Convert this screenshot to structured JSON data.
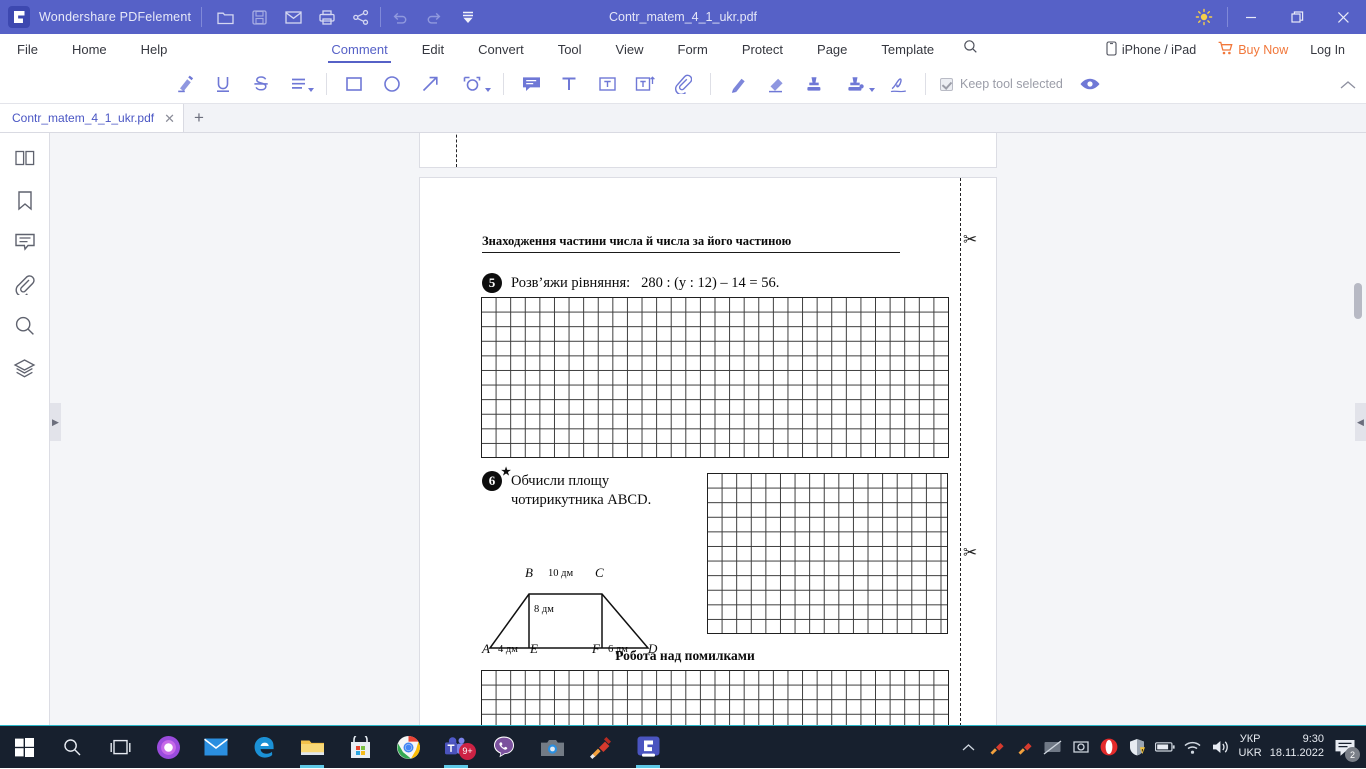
{
  "app": {
    "name": "Wondershare PDFelement",
    "document_title": "Contr_matem_4_1_ukr.pdf",
    "logo_icon": "pdfelement-logo-icon",
    "titlebar_icons": [
      "open-folder-icon",
      "save-icon",
      "email-icon",
      "print-icon",
      "share-icon",
      "undo-icon",
      "redo-icon",
      "customize-toolbar-icon"
    ],
    "window_controls": {
      "theme_icon": "brightness-sun-icon",
      "minimize": "minimize-icon",
      "maximize": "restore-icon",
      "close": "close-icon"
    }
  },
  "menu": {
    "left": [
      "File",
      "Home",
      "Help"
    ],
    "center": [
      "Comment",
      "Edit",
      "Convert",
      "Tool",
      "View",
      "Form",
      "Protect",
      "Page",
      "Template"
    ],
    "active": "Comment",
    "search_icon": "search-icon",
    "right": {
      "device_label": "iPhone / iPad",
      "device_icon": "mobile-device-icon",
      "buy_label": "Buy Now",
      "buy_icon": "shopping-cart-icon",
      "buy_color": "#f1773a",
      "login_label": "Log In"
    }
  },
  "toolbar": {
    "tools": [
      "highlight-icon",
      "underline-icon",
      "strikethrough-icon",
      "text-lines-icon",
      "rectangle-icon",
      "ellipse-icon",
      "arrow-icon",
      "shapes-more-icon",
      "note-comment-icon",
      "text-box-icon",
      "typewriter-icon",
      "text-callout-icon",
      "attachment-icon",
      "pencil-icon",
      "eraser-icon",
      "stamp-icon",
      "custom-stamp-icon",
      "signature-icon"
    ],
    "keep_tool_selected_label": "Keep tool selected",
    "keep_tool_selected_checked": true,
    "visibility_icon": "eye-icon",
    "collapse_icon": "chevron-up-icon"
  },
  "tabs": {
    "items": [
      {
        "label": "Contr_matem_4_1_ukr.pdf",
        "active": true,
        "close_icon": "close-icon"
      }
    ],
    "add_tab_icon": "plus-icon"
  },
  "sidebar": {
    "items": [
      {
        "name": "thumbnails",
        "icon": "thumbnail-panel-icon"
      },
      {
        "name": "bookmarks",
        "icon": "bookmark-icon"
      },
      {
        "name": "comments",
        "icon": "comment-bubble-icon"
      },
      {
        "name": "attachments",
        "icon": "paperclip-icon"
      },
      {
        "name": "search",
        "icon": "magnifier-icon"
      },
      {
        "name": "layers",
        "icon": "layers-icon"
      }
    ]
  },
  "document": {
    "section_heading": "Знаходження частини числа й числа за його частиною",
    "tasks": [
      {
        "number": "5",
        "starred": false,
        "prompt": "Розв’яжи рівняння:",
        "equation": "280 : (y : 12) – 14 = 56.",
        "grid": {
          "cols": 32,
          "rows": 11
        }
      },
      {
        "number": "6",
        "starred": true,
        "line1": "Обчисли площу",
        "line2": "чотирикутника ABCD.",
        "grid": {
          "cols": 16,
          "rows": 11
        }
      }
    ],
    "figure": {
      "vertices": [
        "A",
        "B",
        "C",
        "D",
        "E",
        "F"
      ],
      "labels": {
        "top_side": "10 дм",
        "height": "8 дм",
        "bottom_left": "4 дм",
        "bottom_right": "6 дм"
      }
    },
    "errors_heading": "Робота над помилками",
    "errors_grid": {
      "cols": 32,
      "rows": 4
    },
    "cut_marks_icon": "scissors-icon"
  },
  "taskbar": {
    "apps": [
      {
        "name": "start",
        "icon": "windows-start-icon"
      },
      {
        "name": "search",
        "icon": "search-icon"
      },
      {
        "name": "task-view",
        "icon": "task-view-icon"
      },
      {
        "name": "cortana",
        "icon": "cortana-icon"
      },
      {
        "name": "mail",
        "icon": "mail-icon"
      },
      {
        "name": "edge",
        "icon": "edge-icon"
      },
      {
        "name": "file-explorer",
        "icon": "folder-icon"
      },
      {
        "name": "microsoft-store",
        "icon": "store-icon"
      },
      {
        "name": "chrome",
        "icon": "chrome-icon"
      },
      {
        "name": "microsoft-teams",
        "icon": "teams-icon",
        "badge": "9+"
      },
      {
        "name": "viber",
        "icon": "viber-icon"
      },
      {
        "name": "screenshot-tool",
        "icon": "camera-icon"
      },
      {
        "name": "ccleaner",
        "icon": "ccleaner-icon"
      },
      {
        "name": "pdfelement",
        "icon": "pdfelement-icon"
      }
    ],
    "tray": {
      "overflow_icon": "chevron-up-icon",
      "icons": [
        "ccleaner-tray-icon",
        "ccleaner-tray-icon-2",
        "no-display-icon",
        "camera-tray-icon",
        "opera-icon",
        "security-warning-icon",
        "battery-icon",
        "wifi-icon",
        "volume-icon"
      ],
      "language_top": "УКР",
      "language_bottom": "UKR",
      "time": "9:30",
      "date": "18.11.2022",
      "notification_icon": "action-center-icon",
      "notification_count": "2"
    }
  },
  "colors": {
    "titlebar": "#5661c7",
    "accent": "#5661c7",
    "toolbar_icon": "#6f78d6",
    "buy_now": "#f1773a",
    "taskbar": "#17202e"
  }
}
